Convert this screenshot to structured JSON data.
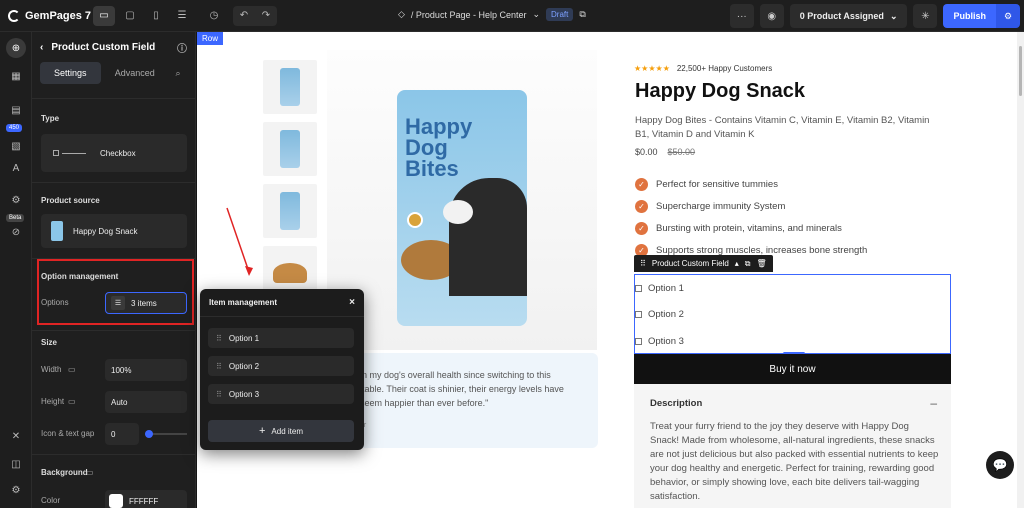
{
  "topbar": {
    "app_name": "GemPages 7",
    "page_title": "/ Product Page - Help Center",
    "status": "Draft",
    "assigned": "0 Product Assigned",
    "publish": "Publish"
  },
  "rail": {
    "badge_450": "450",
    "badge_beta": "Beta"
  },
  "panel": {
    "title": "Product Custom Field",
    "tabs": [
      "Settings",
      "Advanced"
    ],
    "type_label": "Type",
    "type_value": "Checkbox",
    "source_label": "Product source",
    "source_value": "Happy Dog Snack",
    "option_mgmt": "Option management",
    "options_label": "Options",
    "options_value": "3 items",
    "size_label": "Size",
    "width_label": "Width",
    "width_value": "100%",
    "height_label": "Height",
    "height_value": "Auto",
    "gap_label": "Icon & text gap",
    "gap_value": "0",
    "bg_label": "Background",
    "color_label": "Color",
    "color_value": "FFFFFF"
  },
  "popup": {
    "title": "Item management",
    "items": [
      "Option 1",
      "Option 2",
      "Option 3"
    ],
    "add": "Add item"
  },
  "canvas": {
    "row_tag": "Row",
    "rating_text": "22,500+ Happy Customers",
    "product_title": "Happy Dog Snack",
    "product_desc": "Happy Dog Bites - Contains Vitamin C, Vitamin E, Vitamin B2, Vitamin B1, Vitamin D and Vitamin K",
    "price": "$0.00",
    "compare_price": "$50.00",
    "features": [
      "Perfect for sensitive tummies",
      "Supercharge immunity System",
      "Bursting with protein, vitamins, and minerals",
      "Supports strong muscles, increases bone strength"
    ],
    "pcf_label": "Product Custom Field",
    "options": [
      "Option 1",
      "Option 2",
      "Option 3"
    ],
    "buy": "Buy it now",
    "desc_title": "Description",
    "desc_text": "Treat your furry friend to the joy they deserve with Happy Dog Snack! Made from wholesome, all-natural ingredients, these snacks are not just delicious but also packed with essential nutrients to keep your dog healthy and energetic. Perfect for training, rewarding good behavior, or simply showing love, each bite delivers tail-wagging satisfaction.",
    "quote_l1": "in my dog's overall health since switching to this",
    "quote_l2": "kable. Their coat is shinier, their energy levels have",
    "quote_l3": "seem happier than ever before.\"",
    "quote_l4": "er",
    "bag_text": "Happy Dog Bites"
  },
  "colors": {
    "accent": "#3c67ff",
    "highlight": "#e02424",
    "check": "#e0733f"
  }
}
